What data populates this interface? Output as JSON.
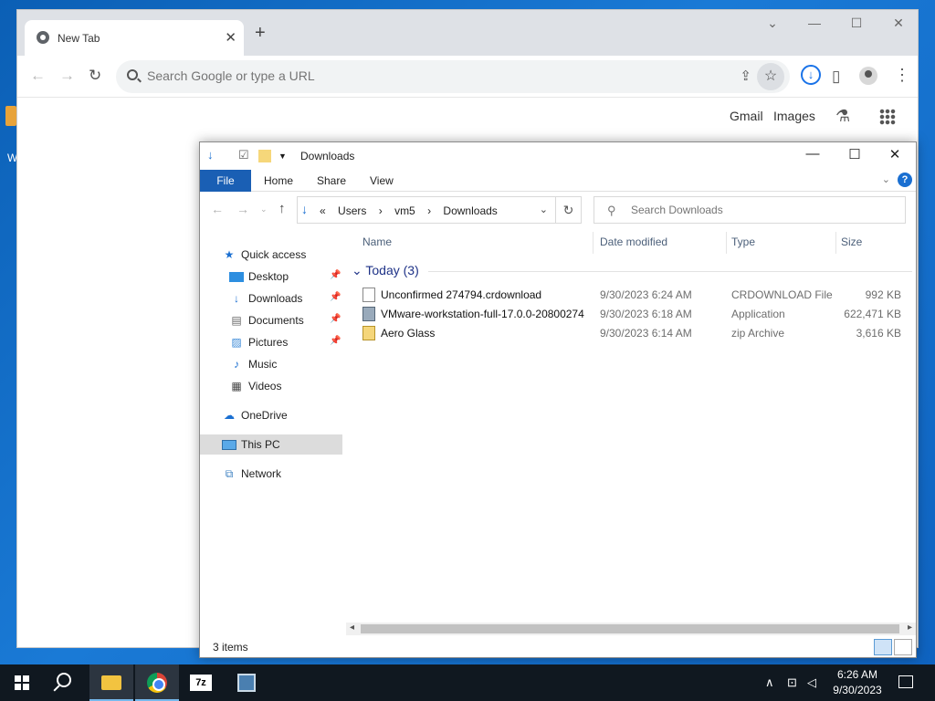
{
  "desktop": {
    "icon_label": "W"
  },
  "chrome": {
    "tab_title": "New Tab",
    "tab_close": "✕",
    "new_tab": "+",
    "minimize": "—",
    "maximize": "☐",
    "close": "✕",
    "dropdown": "⌄",
    "back": "←",
    "forward": "→",
    "reload": "↻",
    "omnibox_placeholder": "Search Google or type a URL",
    "share": "⇪",
    "bookmark": "☆",
    "download": "↓",
    "sidepanel": "▯",
    "menu": "⋮",
    "links": {
      "gmail": "Gmail",
      "images": "Images"
    },
    "labs": "⚗"
  },
  "explorer": {
    "title": "Downloads",
    "minimize": "—",
    "maximize": "☐",
    "close": "✕",
    "ribbon_tabs": [
      "File",
      "Home",
      "Share",
      "View"
    ],
    "help": "?",
    "address": {
      "prefix": "«",
      "crumbs": [
        "Users",
        "vm5",
        "Downloads"
      ]
    },
    "search_placeholder": "Search Downloads",
    "nav": {
      "quick_access": "Quick access",
      "desktop": "Desktop",
      "downloads": "Downloads",
      "documents": "Documents",
      "pictures": "Pictures",
      "music": "Music",
      "videos": "Videos",
      "onedrive": "OneDrive",
      "this_pc": "This PC",
      "network": "Network"
    },
    "columns": {
      "name": "Name",
      "date": "Date modified",
      "type": "Type",
      "size": "Size"
    },
    "group_header": "Today (3)",
    "files": [
      {
        "name": "Unconfirmed 274794.crdownload",
        "date": "9/30/2023 6:24 AM",
        "type": "CRDOWNLOAD File",
        "size": "992 KB"
      },
      {
        "name": "VMware-workstation-full-17.0.0-20800274",
        "date": "9/30/2023 6:18 AM",
        "type": "Application",
        "size": "622,471 KB"
      },
      {
        "name": "Aero Glass",
        "date": "9/30/2023 6:14 AM",
        "type": "zip Archive",
        "size": "3,616 KB"
      }
    ],
    "status": "3 items"
  },
  "taskbar": {
    "app_7z": "7z",
    "time": "6:26 AM",
    "date": "9/30/2023"
  }
}
